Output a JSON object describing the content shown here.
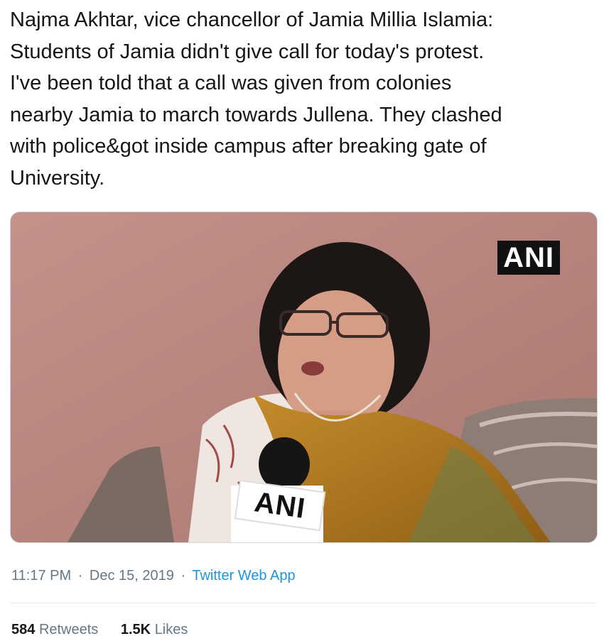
{
  "tweet": {
    "text_lines": [
      "Najma Akhtar, vice chancellor of Jamia Millia Islamia:",
      "Students of Jamia didn't give call for today's protest.",
      "I've been told that a call was given from colonies",
      "nearby Jamia to march towards Jullena. They clashed",
      "with police&got inside campus after breaking gate of",
      "University."
    ],
    "media": {
      "watermark": "ANI",
      "mic_label": "ANI"
    },
    "time": "11:17 PM",
    "date": "Dec 15, 2019",
    "separator": "·",
    "source": "Twitter Web App",
    "retweets_count": "584",
    "retweets_label": "Retweets",
    "likes_count": "1.5K",
    "likes_label": "Likes"
  },
  "colors": {
    "text": "#14171a",
    "secondary": "#657786",
    "link": "#1b95e0",
    "wall": "#b78680"
  }
}
